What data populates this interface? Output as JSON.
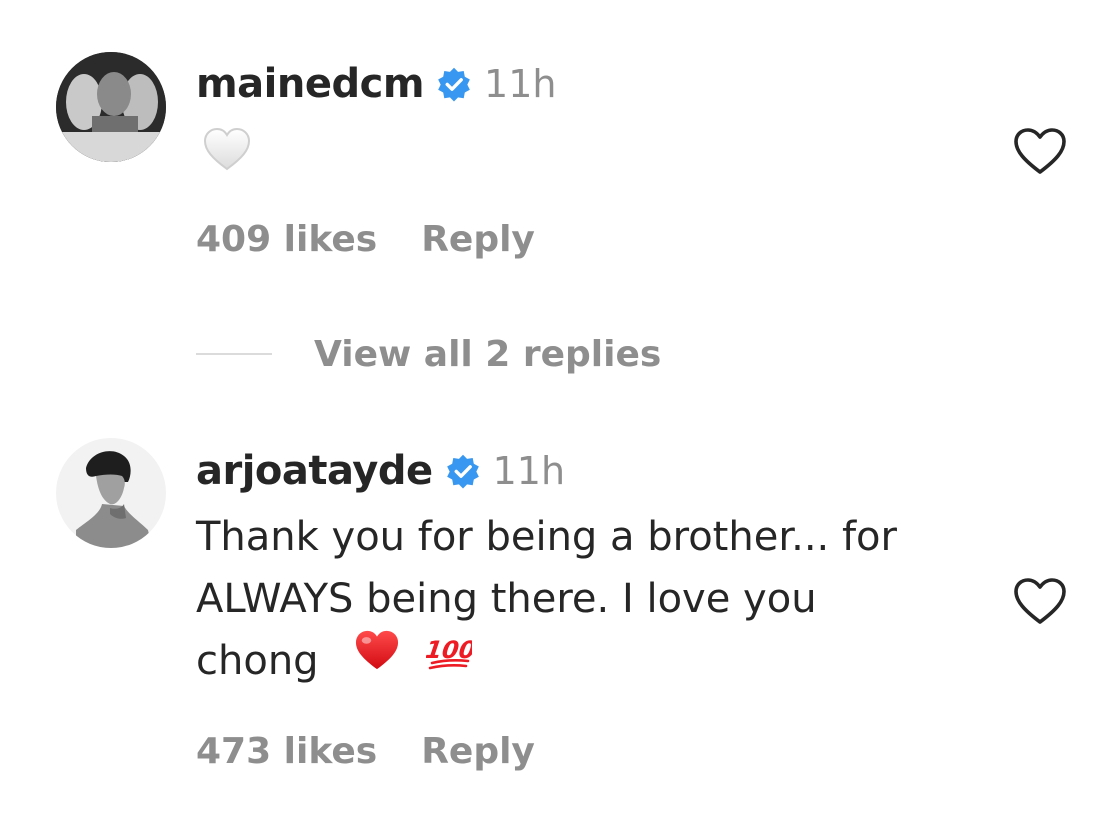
{
  "colors": {
    "text": "#262626",
    "muted": "#8e8e8e",
    "verified": "#3897f0",
    "red": "#ed1c24"
  },
  "comments": [
    {
      "username": "mainedcm",
      "time": "11h",
      "body_icon": "white-heart-emoji-icon",
      "likes": "409 likes",
      "reply": "Reply"
    },
    {
      "username": "arjoatayde",
      "time": "11h",
      "body_line_1": "Thank you for being a brother... for",
      "body_line_2": "ALWAYS being there. I love you",
      "body_line_3": "chong",
      "body_emojis": [
        "red-heart-emoji-icon",
        "hundred-points-emoji-icon"
      ],
      "likes": "473 likes",
      "reply": "Reply"
    }
  ],
  "view_replies": "View all 2 replies"
}
